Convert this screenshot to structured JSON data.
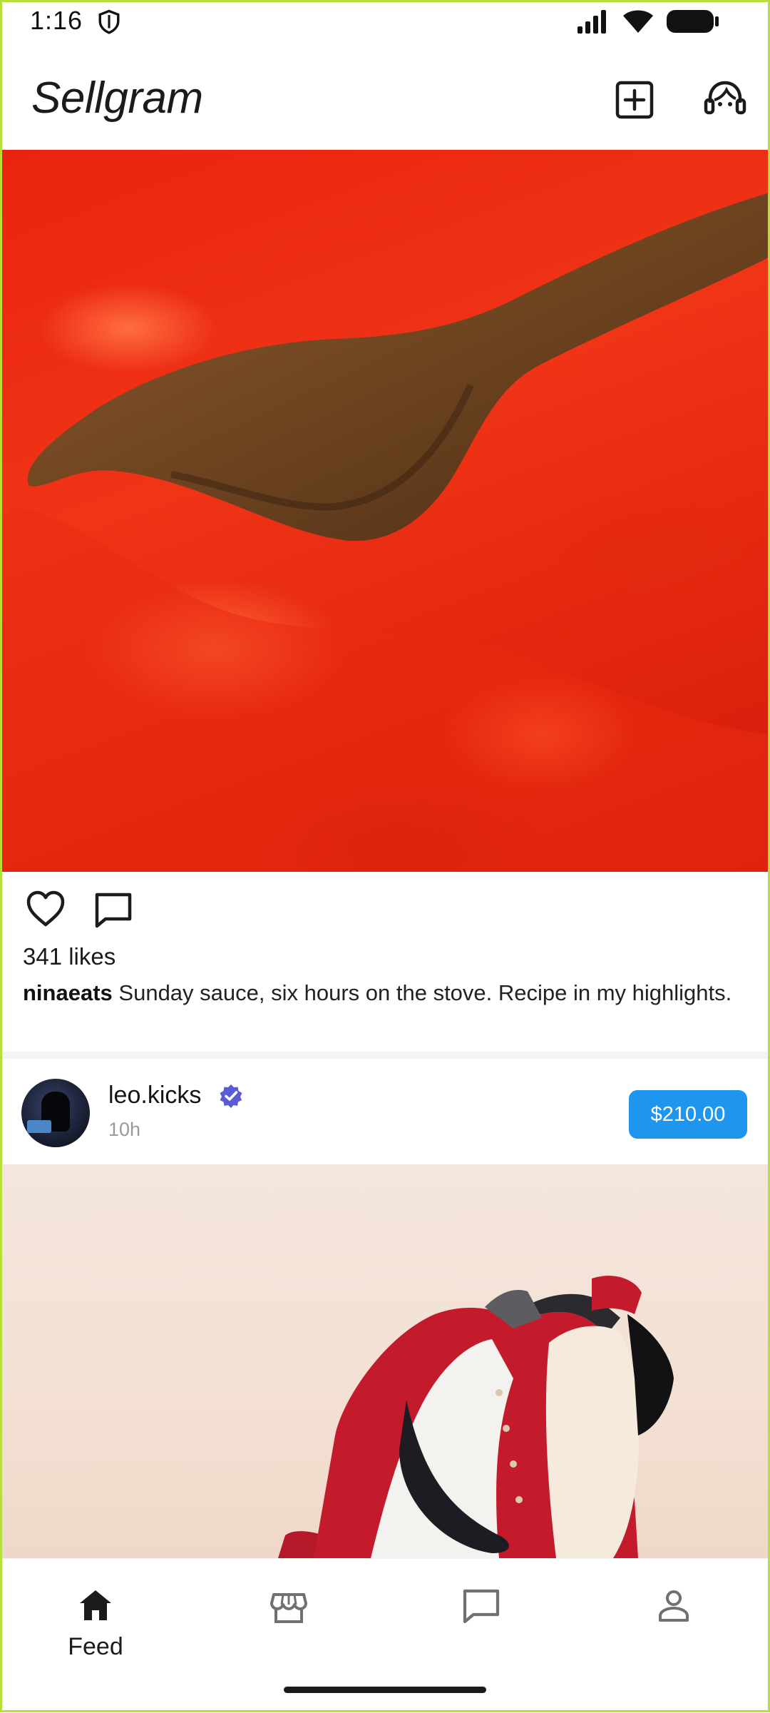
{
  "status_bar": {
    "time": "1:16",
    "shield_icon": "shield-icon",
    "signal_icon": "signal-icon",
    "wifi_icon": "wifi-icon",
    "battery_icon": "battery-icon"
  },
  "header": {
    "title": "Sellgram",
    "add_icon": "add-square-icon",
    "support_icon": "support-agent-icon"
  },
  "post1": {
    "image_description_icon": "image",
    "likes": "341 likes",
    "username": "ninaeats",
    "caption": "Sunday sauce, six hours on the stove. Recipe in my highlights."
  },
  "post2": {
    "username": "leo.kicks",
    "verified": true,
    "time": "10h",
    "price": "$210.00"
  },
  "bottom_nav": {
    "items": [
      {
        "label": "Feed",
        "icon": "home-icon",
        "active": true
      },
      {
        "label": "",
        "icon": "store-icon",
        "active": false
      },
      {
        "label": "",
        "icon": "chat-icon",
        "active": false
      },
      {
        "label": "",
        "icon": "person-icon",
        "active": false
      }
    ]
  },
  "colors": {
    "accent": "#1f96ee",
    "verified": "#5b5bd6",
    "frame": "#b6df3a"
  }
}
